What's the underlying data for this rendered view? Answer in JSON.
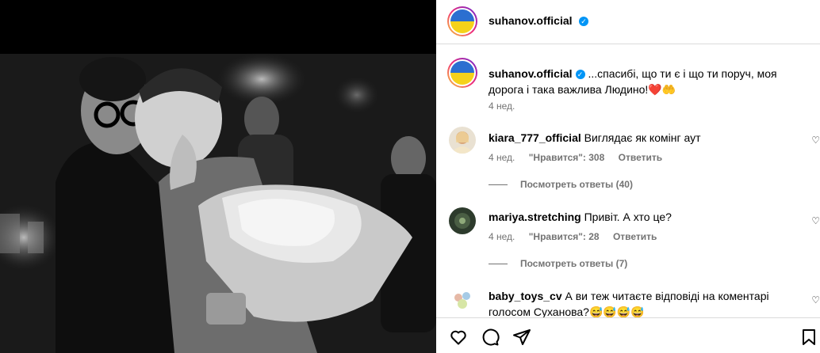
{
  "post": {
    "header_username": "suhanov.official",
    "caption_username": "suhanov.official",
    "caption_text": "...спасибі, що ти є і що ти поруч, моя дорога і така важлива Людино!❤️🤲",
    "caption_time": "4 нед."
  },
  "comments": [
    {
      "username": "kiara_777_official",
      "text": "Виглядає як комінг аут",
      "time": "4 нед.",
      "likes": "\"Нравится\": 308",
      "reply": "Ответить",
      "view_replies": "Посмотреть ответы (40)"
    },
    {
      "username": "mariya.stretching",
      "text": "Привіт. А хто це?",
      "time": "4 нед.",
      "likes": "\"Нравится\": 28",
      "reply": "Ответить",
      "view_replies": "Посмотреть ответы (7)"
    },
    {
      "username": "baby_toys_cv",
      "text": "А ви теж читаєте відповіді на коментарі голосом Суханова?😅😅😅😅"
    }
  ],
  "icons": {
    "verified": "verified-badge-icon",
    "like": "heart-icon",
    "comment": "comment-icon",
    "share": "share-icon",
    "save": "bookmark-icon"
  }
}
